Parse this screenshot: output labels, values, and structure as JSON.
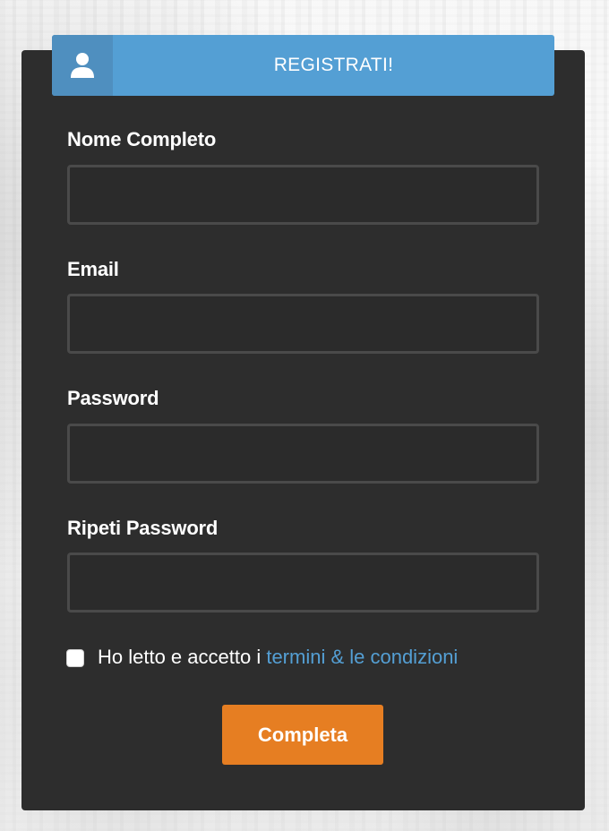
{
  "header": {
    "title": "REGISTRATI!",
    "icon": "user-icon"
  },
  "form": {
    "fields": [
      {
        "label": "Nome Completo",
        "value": "",
        "placeholder": ""
      },
      {
        "label": "Email",
        "value": "",
        "placeholder": ""
      },
      {
        "label": "Password",
        "value": "",
        "placeholder": ""
      },
      {
        "label": "Ripeti Password",
        "value": "",
        "placeholder": ""
      }
    ],
    "terms": {
      "checked": false,
      "text": "Ho letto e accetto i ",
      "link_text": "termini & le condizioni"
    },
    "submit_label": "Completa"
  },
  "colors": {
    "header_bg": "#549fd4",
    "header_icon_bg": "#4f8fbf",
    "card_bg": "#2d2d2d",
    "input_border": "#4a4a4a",
    "link": "#549fd4",
    "button": "#e67e22"
  }
}
